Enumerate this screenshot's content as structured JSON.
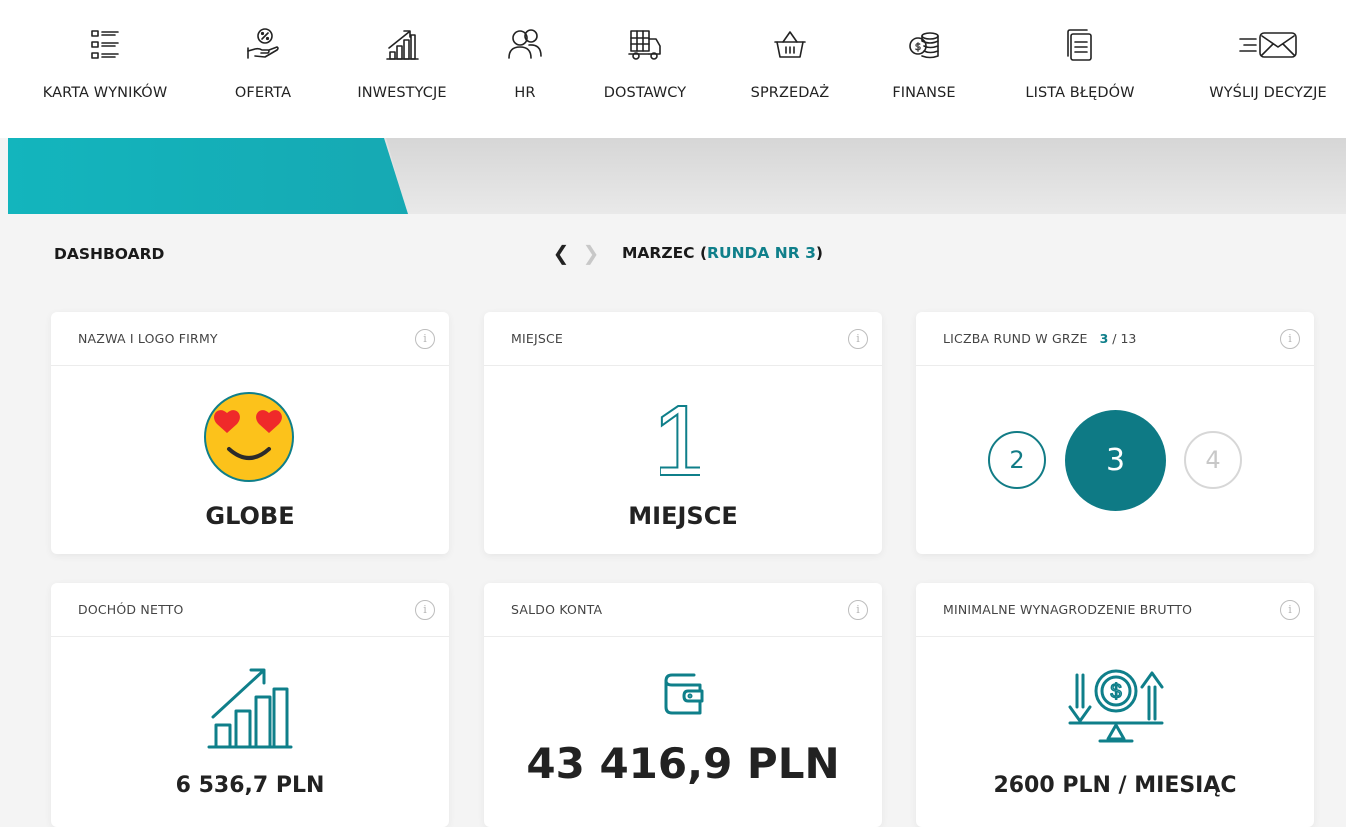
{
  "nav": {
    "items": [
      {
        "label": "KARTA WYNIKÓW",
        "icon": "scorecard-list-icon"
      },
      {
        "label": "OFERTA",
        "icon": "offer-percent-hand-icon"
      },
      {
        "label": "INWESTYCJE",
        "icon": "investment-chart-icon"
      },
      {
        "label": "HR",
        "icon": "people-icon"
      },
      {
        "label": "DOSTAWCY",
        "icon": "delivery-truck-icon"
      },
      {
        "label": "SPRZEDAŻ",
        "icon": "shopping-basket-icon"
      },
      {
        "label": "FINANSE",
        "icon": "coins-icon"
      },
      {
        "label": "LISTA BŁĘDÓW",
        "icon": "document-list-icon"
      },
      {
        "label": "WYŚLIJ DECYZJE",
        "icon": "send-mail-icon"
      }
    ]
  },
  "header": {
    "title": "DASHBOARD",
    "month": "MARZEC (",
    "round": "RUNDA NR 3",
    "close": ")"
  },
  "cards": {
    "company": {
      "title": "NAZWA I LOGO FIRMY",
      "name": "GLOBE",
      "logo": "heart-eyes-emoji-icon"
    },
    "place": {
      "title": "MIEJSCE",
      "number": "1",
      "label": "MIEJSCE"
    },
    "rounds": {
      "title": "LICZBA RUND W GRZE",
      "current": "3",
      "total": "/ 13",
      "prev": "2",
      "cur": "3",
      "next": "4"
    },
    "income": {
      "title": "DOCHÓD NETTO",
      "value": "6 536,7 PLN",
      "icon": "growth-chart-icon"
    },
    "balance": {
      "title": "SALDO KONTA",
      "value": "43 416,9 PLN",
      "icon": "wallet-icon"
    },
    "wage": {
      "title": "MINIMALNE WYNAGRODZENIE BRUTTO",
      "value": "2600 PLN / MIESIĄC",
      "icon": "balance-dollar-icon"
    }
  },
  "colors": {
    "accent": "#0e7a85",
    "banner": "#13b5bd"
  }
}
